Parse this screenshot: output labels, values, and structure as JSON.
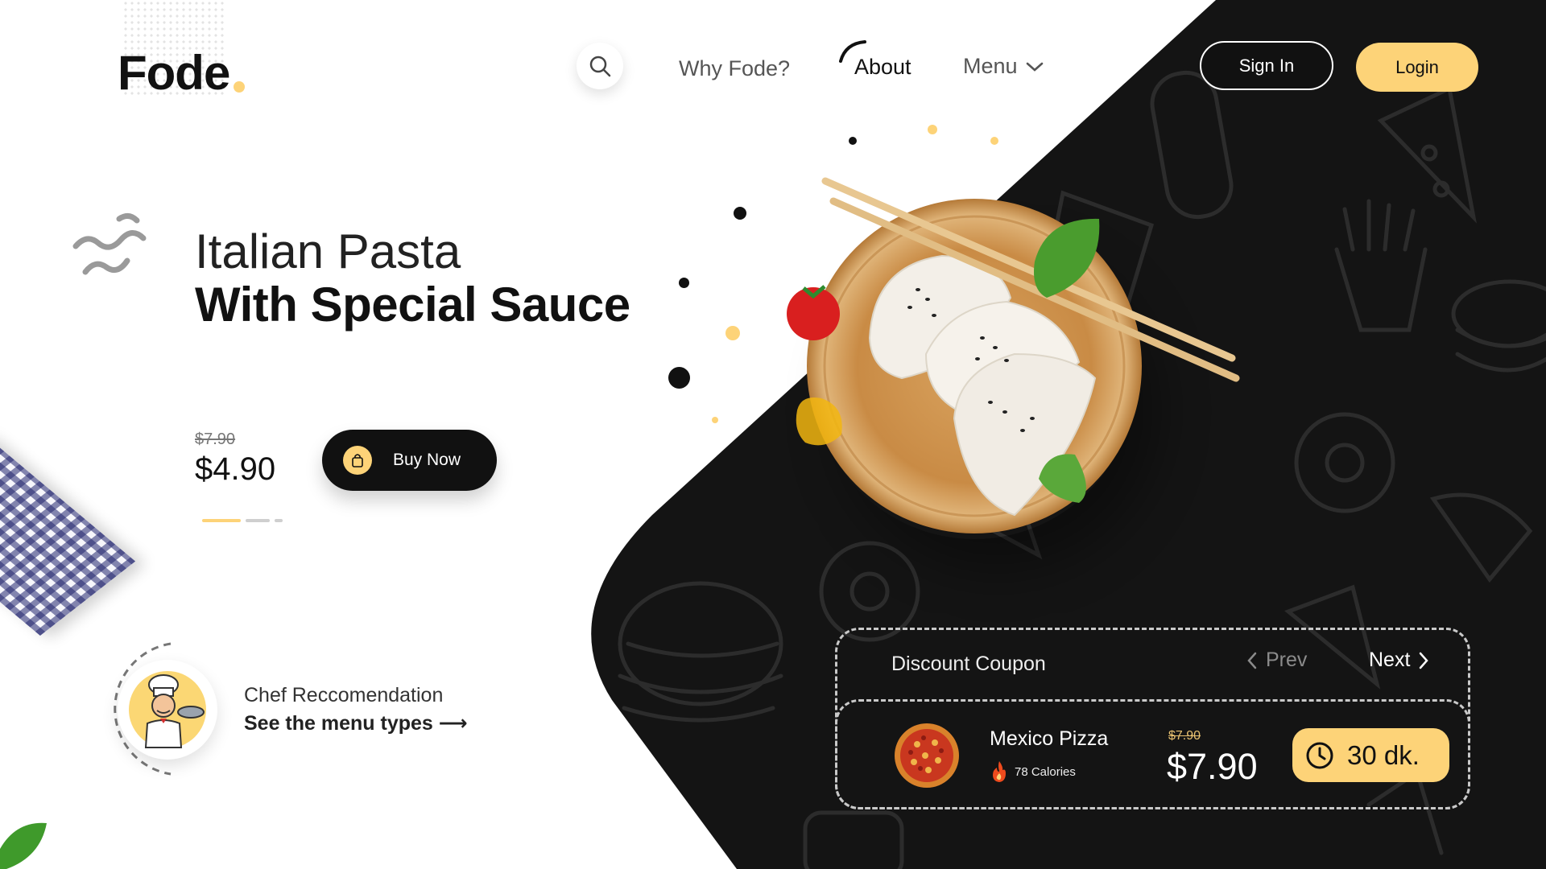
{
  "brand": {
    "name": "Fode"
  },
  "nav": {
    "why": "Why Fode?",
    "about": "About",
    "menu": "Menu"
  },
  "auth": {
    "sign_in": "Sign In",
    "login": "Login"
  },
  "hero": {
    "line1": "Italian Pasta",
    "line2": "With Special Sauce",
    "old_price": "$7.90",
    "price": "$4.90",
    "buy_label": "Buy Now",
    "slide_active_index": 0,
    "slide_count": 3
  },
  "chef": {
    "title": "Chef Reccomendation",
    "link": "See the menu types ⟶"
  },
  "coupon": {
    "title": "Discount Coupon",
    "prev": "Prev",
    "next": "Next",
    "item_name": "Mexico Pizza",
    "calories": "78 Calories",
    "old_price": "$7.90",
    "price": "$7.90",
    "time": "30 dk."
  },
  "icons": {
    "search": "search-icon",
    "menu_chevron": "chevron-down-icon",
    "bag": "shopping-bag-icon",
    "prev": "chevron-left-icon",
    "next": "chevron-right-icon",
    "fire": "fire-icon",
    "clock": "clock-icon"
  },
  "colors": {
    "accent": "#fdd378",
    "dark": "#141414",
    "text": "#111111"
  }
}
